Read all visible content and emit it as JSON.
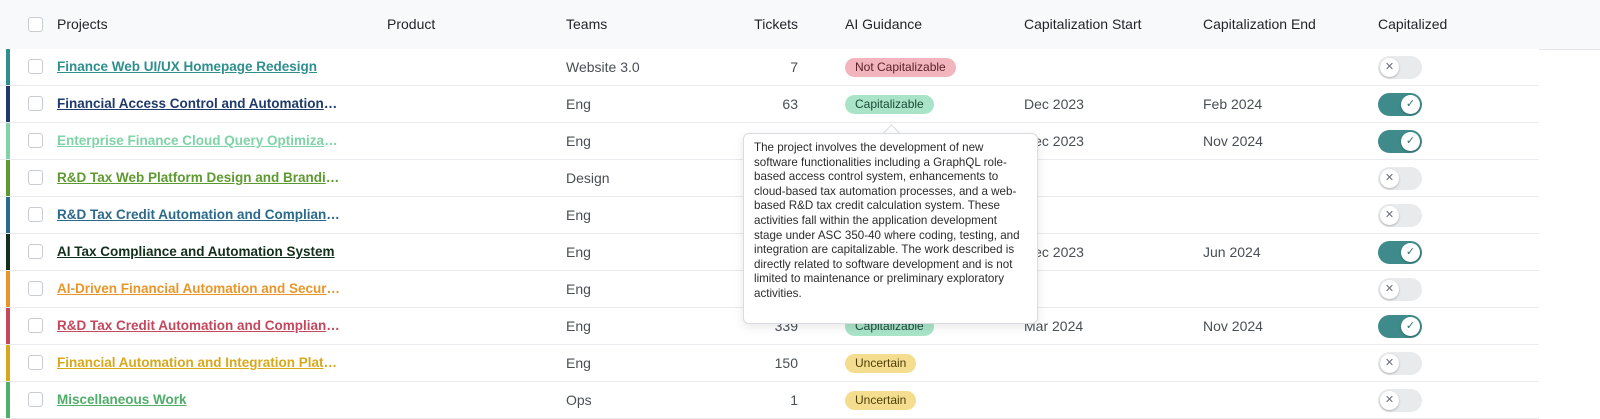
{
  "header": {
    "projects": "Projects",
    "product": "Product",
    "teams": "Teams",
    "tickets": "Tickets",
    "ai_guidance": "AI Guidance",
    "cap_start": "Capitalization Start",
    "cap_end": "Capitalization End",
    "capitalized": "Capitalized"
  },
  "rows": [
    {
      "project": "Finance Web UI/UX Homepage Redesign",
      "team": "Website 3.0",
      "tickets": "7",
      "guidance": "Not Capitalizable",
      "start": "",
      "end": "",
      "capitalized": false,
      "color": "#2f8f8f"
    },
    {
      "project": "Financial Access Control and Automation Enhancements",
      "team": "Eng",
      "tickets": "63",
      "guidance": "Capitalizable",
      "start": "Dec 2023",
      "end": "Feb 2024",
      "capitalized": true,
      "color": "#1f3a6b"
    },
    {
      "project": "Enterprise Finance Cloud Query Optimization",
      "team": "Eng",
      "tickets": "",
      "guidance": "",
      "start": "Dec 2023",
      "end": "Nov 2024",
      "capitalized": true,
      "color": "#7fd3a7"
    },
    {
      "project": "R&D Tax Web Platform Design and Branding",
      "team": "Design",
      "tickets": "",
      "guidance": "",
      "start": "",
      "end": "",
      "capitalized": false,
      "color": "#5e9a2f"
    },
    {
      "project": "R&D Tax Credit Automation and Compliance",
      "team": "Eng",
      "tickets": "",
      "guidance": "",
      "start": "",
      "end": "",
      "capitalized": false,
      "color": "#2c6a8c"
    },
    {
      "project": "AI Tax Compliance and Automation System",
      "team": "Eng",
      "tickets": "",
      "guidance": "",
      "start": "Dec 2023",
      "end": "Jun 2024",
      "capitalized": true,
      "color": "#12301c"
    },
    {
      "project": "AI-Driven Financial Automation and Security",
      "team": "Eng",
      "tickets": "",
      "guidance": "",
      "start": "",
      "end": "",
      "capitalized": false,
      "color": "#e8962a"
    },
    {
      "project": "R&D Tax Credit Automation and Compliance",
      "team": "Eng",
      "tickets": "339",
      "guidance": "Capitalizable",
      "start": "Mar 2024",
      "end": "Nov 2024",
      "capitalized": true,
      "color": "#c4475e"
    },
    {
      "project": "Financial Automation and Integration Platform",
      "team": "Eng",
      "tickets": "150",
      "guidance": "Uncertain",
      "start": "",
      "end": "",
      "capitalized": false,
      "color": "#d8a81c"
    },
    {
      "project": "Miscellaneous Work",
      "team": "Ops",
      "tickets": "1",
      "guidance": "Uncertain",
      "start": "",
      "end": "",
      "capitalized": false,
      "color": "#4fae69"
    }
  ],
  "tooltip": {
    "text": "The project involves the development of new software functionalities including a GraphQL role-based access control system, enhancements to cloud-based tax automation processes, and a web-based R&D tax credit calculation system. These activities fall within the application development stage under ASC 350-40 where coding, testing, and integration are capitalizable. The work described is directly related to software development and is not limited to maintenance or preliminary exploratory activities."
  },
  "colors": {
    "toggle_on": "#3f8a8a",
    "toggle_off": "#e9eaec",
    "badge_not_capitalizable": "#f2b5be",
    "badge_capitalizable": "#a9e4c9",
    "badge_uncertain": "#f4dd8e"
  }
}
